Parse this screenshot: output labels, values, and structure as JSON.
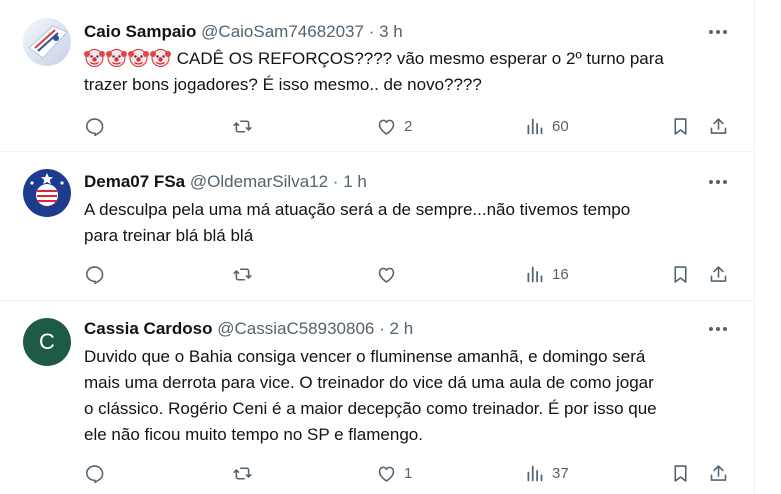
{
  "tweets": [
    {
      "name": "Caio Sampaio",
      "handle": "@CaioSam74682037",
      "dot": "·",
      "time": "3 h",
      "emojis": [
        "clown-face",
        "clown-face",
        "clown-face",
        "clown-face"
      ],
      "text_line1": "CADÊ OS REFORÇOS???? vão mesmo esperar o 2º turno para",
      "text_line2": "trazer bons jogadores? É isso mesmo.. de novo????",
      "likes": "2",
      "views": "60"
    },
    {
      "name": "Dema07 FSa",
      "handle": "@OldemarSilva12",
      "dot": "·",
      "time": "1 h",
      "text_line1": "A desculpa pela uma má atuação será a de sempre...não tivemos tempo",
      "text_line2": "para treinar blá blá blá",
      "likes": "",
      "views": "16"
    },
    {
      "name": "Cassia Cardoso",
      "handle": "@CassiaC58930806",
      "dot": "·",
      "time": "2 h",
      "avatar_letter": "C",
      "text_line1": "Duvido que o Bahia consiga vencer o fluminense amanhã, e domingo será",
      "text_line2": "mais uma derrota para vice. O treinador do vice dá uma aula de como jogar",
      "text_line3": "o clássico. Rogério Ceni é a maior decepção como treinador. É por isso que",
      "text_line4": "ele não ficou muito tempo no SP e flamengo.",
      "likes": "1",
      "views": "37"
    }
  ],
  "icons": [
    "more-icon",
    "reply-icon",
    "retweet-icon",
    "like-icon",
    "views-icon",
    "bookmark-icon",
    "share-icon"
  ],
  "colors": {
    "text": "#0f1419",
    "secondary": "#536471",
    "divider": "#eff3f4",
    "avatar_c": "#1e5b45"
  }
}
